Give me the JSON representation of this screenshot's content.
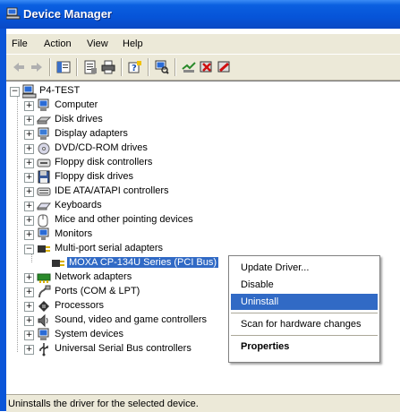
{
  "window": {
    "title": "Device Manager"
  },
  "menu": [
    "File",
    "Action",
    "View",
    "Help"
  ],
  "toolbar": [
    "back-arrow-icon",
    "forward-arrow-icon",
    "show-hide-console-icon",
    "properties-icon",
    "print-icon",
    "help-icon",
    "scan-hardware-icon",
    "update-driver-icon",
    "uninstall-icon",
    "disable-icon"
  ],
  "tree": {
    "root": "P4-TEST",
    "items": [
      "Computer",
      "Disk drives",
      "Display adapters",
      "DVD/CD-ROM drives",
      "Floppy disk controllers",
      "Floppy disk drives",
      "IDE ATA/ATAPI controllers",
      "Keyboards",
      "Mice and other pointing devices",
      "Monitors",
      "Multi-port serial adapters",
      "MOXA CP-134U Series (PCI Bus)",
      "Network adapters",
      "Ports (COM & LPT)",
      "Processors",
      "Sound, video and game controllers",
      "System devices",
      "Universal Serial Bus controllers"
    ]
  },
  "context_menu": {
    "update_driver": "Update Driver...",
    "disable": "Disable",
    "uninstall": "Uninstall",
    "scan": "Scan for hardware changes",
    "properties": "Properties"
  },
  "status_text": "Uninstalls the driver for the selected device."
}
